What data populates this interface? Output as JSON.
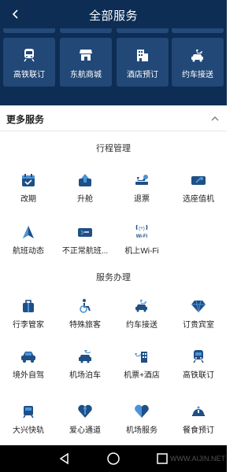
{
  "header": {
    "title": "全部服务"
  },
  "quick_services": [
    {
      "label": "高铁联订",
      "icon": "train-icon"
    },
    {
      "label": "东航商城",
      "icon": "shop-icon"
    },
    {
      "label": "酒店预订",
      "icon": "hotel-icon"
    },
    {
      "label": "约车接送",
      "icon": "car-plane-icon"
    }
  ],
  "more": {
    "title": "更多服务"
  },
  "sections": [
    {
      "title": "行程管理",
      "items": [
        {
          "label": "改期",
          "icon": "calendar-icon"
        },
        {
          "label": "升舱",
          "icon": "upgrade-icon"
        },
        {
          "label": "退票",
          "icon": "refund-icon"
        },
        {
          "label": "选座值机",
          "icon": "seat-checkin-icon"
        },
        {
          "label": "航班动态",
          "icon": "flight-status-icon"
        },
        {
          "label": "不正常航班...",
          "icon": "irregular-flight-icon"
        },
        {
          "label": "机上Wi-Fi",
          "icon": "wifi-icon"
        }
      ]
    },
    {
      "title": "服务办理",
      "items": [
        {
          "label": "行李管家",
          "icon": "luggage-icon"
        },
        {
          "label": "特殊旅客",
          "icon": "wheelchair-icon"
        },
        {
          "label": "约车接送",
          "icon": "car-plane-icon"
        },
        {
          "label": "订贵宾室",
          "icon": "diamond-icon"
        },
        {
          "label": "境外自驾",
          "icon": "car-icon"
        },
        {
          "label": "机场泊车",
          "icon": "parking-icon"
        },
        {
          "label": "机票+酒店",
          "icon": "flight-hotel-icon"
        },
        {
          "label": "高铁联订",
          "icon": "train-icon"
        },
        {
          "label": "大兴快轨",
          "icon": "metro-icon"
        },
        {
          "label": "爱心通道",
          "icon": "care-icon"
        },
        {
          "label": "机场服务",
          "icon": "heart-icon"
        },
        {
          "label": "餐食预订",
          "icon": "meal-icon"
        }
      ]
    }
  ],
  "wifi_icon_text": "Wi-Fi",
  "watermark": "WWW.AIJIN.NET",
  "colors": {
    "header_bg": "#0d2d54",
    "card_bg": "#224877",
    "icon": "#1f4f85",
    "icon_accent": "#4b93d6"
  }
}
